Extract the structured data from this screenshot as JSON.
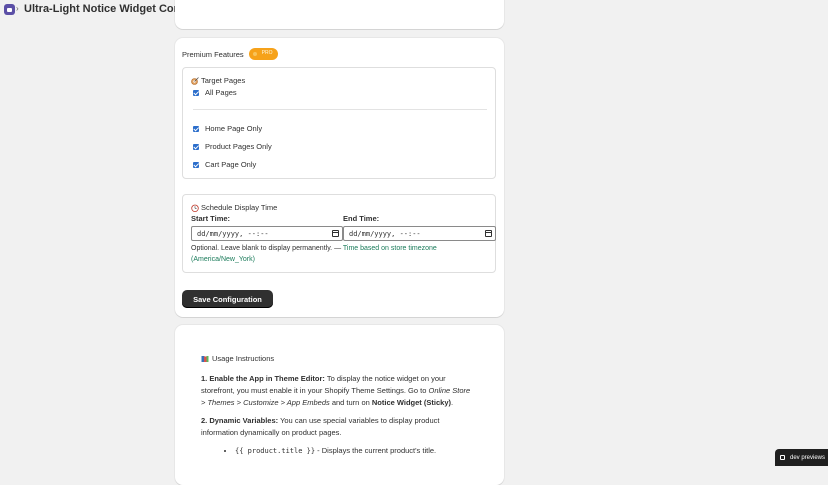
{
  "header": {
    "breadcrumb_separator": "›",
    "title": "Ultra-Light Notice Widget Configuration"
  },
  "premium": {
    "label": "Premium Features",
    "badge": "PRO"
  },
  "target_pages": {
    "heading": "Target Pages",
    "icon": "target-icon",
    "all_pages": {
      "label": "All Pages",
      "checked": true
    },
    "options": [
      {
        "label": "Home Page Only",
        "checked": true
      },
      {
        "label": "Product Pages Only",
        "checked": true
      },
      {
        "label": "Cart Page Only",
        "checked": true
      }
    ]
  },
  "schedule": {
    "heading": "Schedule Display Time",
    "icon": "clock-icon",
    "start_label": "Start Time:",
    "end_label": "End Time:",
    "start_value": "dd/mm/yyyy, --:--",
    "end_value": "dd/mm/yyyy, --:--",
    "help_text": "Optional. Leave blank to display permanently. — ",
    "help_accent": "Time based on store timezone (America/New_York)"
  },
  "save_label": "Save Configuration",
  "usage": {
    "heading": "Usage Instructions",
    "icon": "book-icon",
    "step1_title": "1. Enable the App in Theme Editor:",
    "step1_text": " To display the notice widget on your storefront, you must enable it in your Shopify Theme Settings. Go to ",
    "step1_path": "Online Store > Themes > Customize > App Embeds",
    "step1_mid": " and turn on ",
    "step1_widget": "Notice Widget (Sticky)",
    "step1_end": ".",
    "step2_title": "2. Dynamic Variables:",
    "step2_text": " You can use special variables to display product information dynamically on product pages.",
    "vars": [
      {
        "code": "{{ product.title }}",
        "desc": " - Displays the current product's title."
      }
    ]
  },
  "dev_badge": "dev previews",
  "colors": {
    "accent_pro": "#f6a21a",
    "checkbox": "#2c6ecb",
    "help_accent": "#1a7b5a",
    "button": "#303030"
  }
}
